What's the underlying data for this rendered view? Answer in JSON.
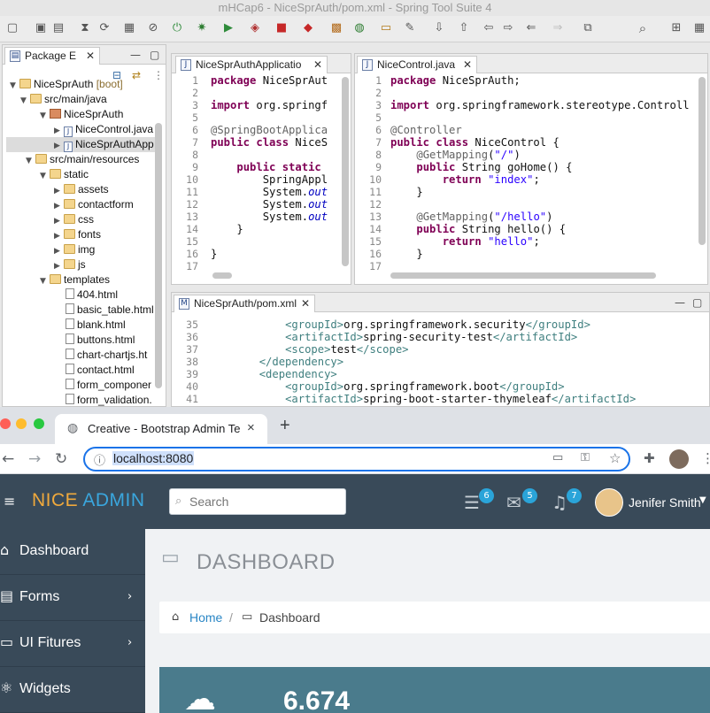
{
  "ide": {
    "window_title": "mHCap6 - NiceSprAuth/pom.xml - Spring Tool Suite 4",
    "package_explorer": {
      "tab_label": "Package E",
      "tree": [
        {
          "label": "NiceSprAuth",
          "decoration": "[boot]"
        },
        {
          "label": "src/main/java"
        },
        {
          "label": "NiceSprAuth"
        },
        {
          "label": "NiceControl.java"
        },
        {
          "label": "NiceSprAuthApp"
        },
        {
          "label": "src/main/resources"
        },
        {
          "label": "static"
        },
        {
          "label": "assets"
        },
        {
          "label": "contactform"
        },
        {
          "label": "css"
        },
        {
          "label": "fonts"
        },
        {
          "label": "img"
        },
        {
          "label": "js"
        },
        {
          "label": "templates"
        },
        {
          "label": "404.html"
        },
        {
          "label": "basic_table.html"
        },
        {
          "label": "blank.html"
        },
        {
          "label": "buttons.html"
        },
        {
          "label": "chart-chartjs.ht"
        },
        {
          "label": "contact.html"
        },
        {
          "label": "form_componer"
        },
        {
          "label": "form_validation."
        }
      ]
    },
    "editor_left": {
      "tab_label": "NiceSprAuthApplicatio",
      "lines": [
        {
          "n": "1",
          "parts": [
            [
              "k",
              "package"
            ],
            [
              "p",
              " NiceSprAut"
            ]
          ]
        },
        {
          "n": "2",
          "parts": [
            [
              "p",
              ""
            ]
          ]
        },
        {
          "n": "3",
          "parts": [
            [
              "k",
              "import"
            ],
            [
              "p",
              " org.springf"
            ]
          ]
        },
        {
          "n": "5",
          "parts": [
            [
              "p",
              ""
            ]
          ]
        },
        {
          "n": "6",
          "parts": [
            [
              "a",
              "@SpringBootApplica"
            ]
          ]
        },
        {
          "n": "7",
          "parts": [
            [
              "k",
              "public class"
            ],
            [
              "p",
              " NiceS"
            ]
          ]
        },
        {
          "n": "8",
          "parts": [
            [
              "p",
              ""
            ]
          ]
        },
        {
          "n": "9",
          "parts": [
            [
              "p",
              "    "
            ],
            [
              "k",
              "public static"
            ]
          ]
        },
        {
          "n": "10",
          "parts": [
            [
              "p",
              "        SpringAppl"
            ]
          ]
        },
        {
          "n": "11",
          "parts": [
            [
              "p",
              "        System."
            ],
            [
              "i",
              "out"
            ]
          ]
        },
        {
          "n": "12",
          "parts": [
            [
              "p",
              "        System."
            ],
            [
              "i",
              "out"
            ]
          ]
        },
        {
          "n": "13",
          "parts": [
            [
              "p",
              "        System."
            ],
            [
              "i",
              "out"
            ]
          ]
        },
        {
          "n": "14",
          "parts": [
            [
              "p",
              "    }"
            ]
          ]
        },
        {
          "n": "15",
          "parts": [
            [
              "p",
              ""
            ]
          ]
        },
        {
          "n": "16",
          "parts": [
            [
              "p",
              "}"
            ]
          ]
        },
        {
          "n": "17",
          "parts": [
            [
              "p",
              ""
            ]
          ]
        }
      ]
    },
    "editor_right": {
      "tab_label": "NiceControl.java",
      "lines": [
        {
          "n": "1",
          "parts": [
            [
              "k",
              "package"
            ],
            [
              "p",
              " NiceSprAuth;"
            ]
          ]
        },
        {
          "n": "2",
          "parts": [
            [
              "p",
              ""
            ]
          ]
        },
        {
          "n": "3",
          "parts": [
            [
              "k",
              "import"
            ],
            [
              "p",
              " org.springframework.stereotype.Controll"
            ]
          ]
        },
        {
          "n": "5",
          "parts": [
            [
              "p",
              ""
            ]
          ]
        },
        {
          "n": "6",
          "parts": [
            [
              "a",
              "@Controller"
            ]
          ]
        },
        {
          "n": "7",
          "parts": [
            [
              "k",
              "public class"
            ],
            [
              "p",
              " NiceControl {"
            ]
          ]
        },
        {
          "n": "8",
          "parts": [
            [
              "p",
              "    "
            ],
            [
              "a",
              "@GetMapping"
            ],
            [
              "p",
              "("
            ],
            [
              "s",
              "\"/\""
            ],
            [
              "p",
              ")"
            ]
          ]
        },
        {
          "n": "9",
          "parts": [
            [
              "p",
              "    "
            ],
            [
              "k",
              "public"
            ],
            [
              "p",
              " String goHome() {"
            ]
          ]
        },
        {
          "n": "10",
          "parts": [
            [
              "p",
              "        "
            ],
            [
              "k",
              "return"
            ],
            [
              "p",
              " "
            ],
            [
              "s",
              "\"index\""
            ],
            [
              "p",
              ";"
            ]
          ]
        },
        {
          "n": "11",
          "parts": [
            [
              "p",
              "    }"
            ]
          ]
        },
        {
          "n": "12",
          "parts": [
            [
              "p",
              ""
            ]
          ]
        },
        {
          "n": "13",
          "parts": [
            [
              "p",
              "    "
            ],
            [
              "a",
              "@GetMapping"
            ],
            [
              "p",
              "("
            ],
            [
              "s",
              "\"/hello\""
            ],
            [
              "p",
              ")"
            ]
          ]
        },
        {
          "n": "14",
          "parts": [
            [
              "p",
              "    "
            ],
            [
              "k",
              "public"
            ],
            [
              "p",
              " String hello() {"
            ]
          ]
        },
        {
          "n": "15",
          "parts": [
            [
              "p",
              "        "
            ],
            [
              "k",
              "return"
            ],
            [
              "p",
              " "
            ],
            [
              "s",
              "\"hello\""
            ],
            [
              "p",
              ";"
            ]
          ]
        },
        {
          "n": "16",
          "parts": [
            [
              "p",
              "    }"
            ]
          ]
        },
        {
          "n": "17",
          "parts": [
            [
              "p",
              ""
            ]
          ]
        }
      ]
    },
    "editor_bottom": {
      "tab_label": "NiceSprAuth/pom.xml",
      "lines": [
        {
          "n": "35",
          "parts": [
            [
              "p",
              "            "
            ],
            [
              "x",
              "<groupId>"
            ],
            [
              "p",
              "org.springframework.security"
            ],
            [
              "x",
              "</groupId>"
            ]
          ]
        },
        {
          "n": "36",
          "parts": [
            [
              "p",
              "            "
            ],
            [
              "x",
              "<artifactId>"
            ],
            [
              "p",
              "spring-security-test"
            ],
            [
              "x",
              "</artifactId>"
            ]
          ]
        },
        {
          "n": "37",
          "parts": [
            [
              "p",
              "            "
            ],
            [
              "x",
              "<scope>"
            ],
            [
              "p",
              "test"
            ],
            [
              "x",
              "</scope>"
            ]
          ]
        },
        {
          "n": "38",
          "parts": [
            [
              "p",
              "        "
            ],
            [
              "x",
              "</dependency>"
            ]
          ]
        },
        {
          "n": "39",
          "parts": [
            [
              "p",
              "        "
            ],
            [
              "x",
              "<dependency>"
            ]
          ]
        },
        {
          "n": "40",
          "parts": [
            [
              "p",
              "            "
            ],
            [
              "x",
              "<groupId>"
            ],
            [
              "p",
              "org.springframework.boot"
            ],
            [
              "x",
              "</groupId>"
            ]
          ]
        },
        {
          "n": "41",
          "parts": [
            [
              "p",
              "            "
            ],
            [
              "x",
              "<artifactId>"
            ],
            [
              "p",
              "spring-boot-starter-thymeleaf"
            ],
            [
              "x",
              "</artifactId>"
            ]
          ]
        }
      ]
    }
  },
  "browser": {
    "tab_title": "Creative - Bootstrap Admin Ter",
    "tab_close": "×",
    "new_tab": "+",
    "address": "localhost:8080",
    "site": {
      "logo_part1": "NICE",
      "logo_part2": "ADMIN",
      "search_placeholder": "Search",
      "badges": {
        "tasks": "6",
        "mail": "5",
        "notifications": "7"
      },
      "user_name": "Jenifer Smith",
      "sidebar": [
        {
          "label": "Dashboard",
          "icon": "house-icon"
        },
        {
          "label": "Forms",
          "icon": "document-icon"
        },
        {
          "label": "UI Fitures",
          "icon": "laptop-icon"
        },
        {
          "label": "Widgets",
          "icon": "atom-icon"
        }
      ],
      "page_title": "DASHBOARD",
      "breadcrumb": {
        "home": "Home",
        "separator": "/",
        "current": "Dashboard"
      },
      "stat_value": "6.674"
    }
  },
  "colors": {
    "site_header": "#394a59",
    "badge": "#2aa4d9",
    "accent": "#2a86c5",
    "stat_card": "#4a7b8c"
  }
}
